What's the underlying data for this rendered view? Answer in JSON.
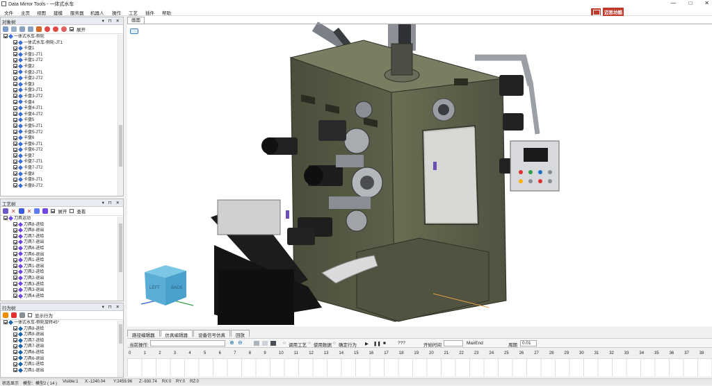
{
  "window": {
    "title": "Data Mirror Tools - 一体式水车",
    "minimize": "—",
    "maximize": "□",
    "close": "✕"
  },
  "menu": [
    "文件",
    "主页",
    "视图",
    "建模",
    "服务器",
    "机器人",
    "操作",
    "工艺",
    "插件",
    "帮助"
  ],
  "brand": {
    "text": "迈思坊酷",
    "color": "#c0392b"
  },
  "object_tree": {
    "header": "对象树",
    "controls": "▾ ⊓ ✕",
    "expand_label": "展开",
    "items": [
      {
        "label": "一体式水车-侧轮",
        "level": 0
      },
      {
        "label": "一体式水车-侧轮-JT1",
        "level": 1
      },
      {
        "label": "卡盘1",
        "level": 1
      },
      {
        "label": "卡盘1-JT1",
        "level": 1
      },
      {
        "label": "卡盘1-JT2",
        "level": 1
      },
      {
        "label": "卡盘2",
        "level": 1
      },
      {
        "label": "卡盘2-JT1",
        "level": 1
      },
      {
        "label": "卡盘2-JT2",
        "level": 1
      },
      {
        "label": "卡盘3",
        "level": 1
      },
      {
        "label": "卡盘3-JT1",
        "level": 1
      },
      {
        "label": "卡盘3-JT2",
        "level": 1
      },
      {
        "label": "卡盘4",
        "level": 1
      },
      {
        "label": "卡盘4-JT1",
        "level": 1
      },
      {
        "label": "卡盘4-JT2",
        "level": 1
      },
      {
        "label": "卡盘5",
        "level": 1
      },
      {
        "label": "卡盘5-JT1",
        "level": 1
      },
      {
        "label": "卡盘5-JT2",
        "level": 1
      },
      {
        "label": "卡盘6",
        "level": 1
      },
      {
        "label": "卡盘6-JT1",
        "level": 1
      },
      {
        "label": "卡盘6-JT2",
        "level": 1
      },
      {
        "label": "卡盘7",
        "level": 1
      },
      {
        "label": "卡盘7-JT1",
        "level": 1
      },
      {
        "label": "卡盘7-JT2",
        "level": 1
      },
      {
        "label": "卡盘8",
        "level": 1
      },
      {
        "label": "卡盘8-JT1",
        "level": 1
      },
      {
        "label": "卡盘8-JT2",
        "level": 1
      }
    ]
  },
  "process_tree": {
    "header": "工艺树",
    "controls": "▾ ⊓ ✕",
    "expand_label": "展开",
    "view_label": "查看",
    "items": [
      {
        "label": "刀具运动",
        "level": 0
      },
      {
        "label": "刀具8-进给",
        "level": 1
      },
      {
        "label": "刀具8-退出",
        "level": 1
      },
      {
        "label": "刀具7-进给",
        "level": 1
      },
      {
        "label": "刀具7-退出",
        "level": 1
      },
      {
        "label": "刀具6-进给",
        "level": 1
      },
      {
        "label": "刀具6-退出",
        "level": 1
      },
      {
        "label": "刀具1-进给",
        "level": 1
      },
      {
        "label": "刀具1-退出",
        "level": 1
      },
      {
        "label": "刀具2-进给",
        "level": 1
      },
      {
        "label": "刀具2-退出",
        "level": 1
      },
      {
        "label": "刀具3-进给",
        "level": 1
      },
      {
        "label": "刀具3-退出",
        "level": 1
      },
      {
        "label": "刀具4-进给",
        "level": 1
      }
    ]
  },
  "behavior_tree": {
    "header": "行为树",
    "controls": "▾ ⊓ ✕",
    "option_label": "显示行为",
    "items": [
      {
        "label": "一体式水车-侧轮旋转45°",
        "level": 0
      },
      {
        "label": "刀具8-进给",
        "level": 1
      },
      {
        "label": "刀具8-退出",
        "level": 1
      },
      {
        "label": "刀具7-进给",
        "level": 1
      },
      {
        "label": "刀具7-退出",
        "level": 1
      },
      {
        "label": "刀具6-进给",
        "level": 1
      },
      {
        "label": "刀具6-退出",
        "level": 1
      },
      {
        "label": "刀具1-进给",
        "level": 1
      },
      {
        "label": "刀具1-退出",
        "level": 1
      }
    ]
  },
  "viewport": {
    "tab": "画面",
    "cube_left": "LEFT",
    "cube_back": "BACK"
  },
  "bottom_tabs": [
    "路径编辑器",
    "仿真编辑器",
    "设备信号仿真",
    "回放"
  ],
  "active_bottom_tab": 1,
  "sequence_bar": {
    "current_label": "当前操作:",
    "radio1": "调用工艺",
    "radio2": "使用数据",
    "radio3": "确定行为",
    "unknown": "???",
    "start_label": "开始时间",
    "max_label": "MaxEnd",
    "period_label": "周期",
    "period_value": "0.01"
  },
  "ruler_ticks": [
    0,
    1,
    2,
    3,
    4,
    5,
    6,
    7,
    8,
    9,
    10,
    11,
    12,
    13,
    14,
    15,
    16,
    17,
    18,
    19,
    20,
    21,
    22,
    23,
    24,
    25,
    26,
    27,
    28,
    29,
    30,
    31,
    32,
    33,
    34,
    35,
    36,
    37,
    38
  ],
  "status": {
    "label": "状态显示",
    "mode": "模型：模型2 ( 14 )",
    "visible": "Visible:1",
    "x": "X:-1240.04",
    "y": "Y:2459.96",
    "z": "Z:-930.74",
    "rx": "RX:0",
    "ry": "RY:0",
    "rz": "RZ:0"
  }
}
